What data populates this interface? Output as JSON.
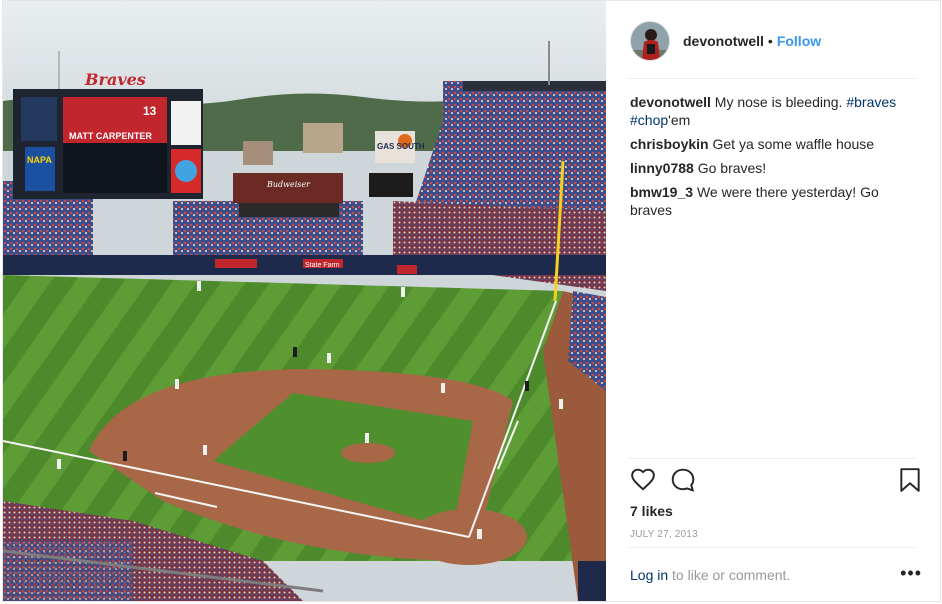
{
  "post": {
    "username": "devonotwell",
    "separator": "•",
    "follow_label": "Follow",
    "comments": [
      {
        "user": "devonotwell",
        "text": "My nose is bleeding. ",
        "tags": [
          "#braves",
          "#chop"
        ],
        "suffix": "'em"
      },
      {
        "user": "chrisboykin",
        "text": "Get ya some waffle house"
      },
      {
        "user": "linny0788",
        "text": "Go braves!"
      },
      {
        "user": "bmw19_3",
        "text": "We were there yesterday! Go braves"
      }
    ],
    "likes": "7 likes",
    "date": "JULY 27, 2013",
    "login_link": "Log in",
    "login_suffix": " to like or comment.",
    "more_label": "•••"
  },
  "photo": {
    "scoreboard_player": "MATT CARPENTER",
    "scoreboard_number": "13",
    "sign_braves": "Braves",
    "sign_nafa": "NAPA",
    "sign_gas_south": "GAS SOUTH",
    "sign_budweiser": "Budweiser",
    "sign_state_farm": "State Farm"
  },
  "icons": [
    "heart-icon",
    "comment-icon",
    "bookmark-icon",
    "more-icon"
  ],
  "colors": {
    "accent": "#3897f0",
    "link_dark": "#003569",
    "muted": "#999999"
  }
}
